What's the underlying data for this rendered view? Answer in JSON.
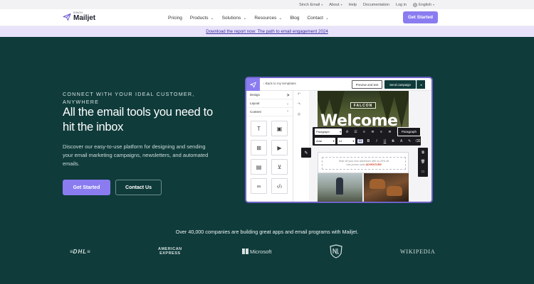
{
  "topbar": {
    "items": [
      {
        "label": "Sinch Email",
        "chevron": true
      },
      {
        "label": "About",
        "chevron": true
      },
      {
        "label": "Help",
        "chevron": false
      },
      {
        "label": "Documentation",
        "chevron": false
      },
      {
        "label": "Log in",
        "chevron": false
      },
      {
        "label": "English",
        "chevron": true,
        "icon": "globe-icon"
      }
    ]
  },
  "nav": {
    "logo_sub": "SINCH",
    "logo_main": "Mailjet",
    "menu": [
      {
        "label": "Pricing",
        "chevron": false
      },
      {
        "label": "Products",
        "chevron": true
      },
      {
        "label": "Solutions",
        "chevron": true
      },
      {
        "label": "Resources",
        "chevron": true
      },
      {
        "label": "Blog",
        "chevron": false
      },
      {
        "label": "Contact",
        "chevron": true
      }
    ],
    "cta": "Get Started"
  },
  "banner": {
    "link": "Download the report now: The path to email engagement 2024"
  },
  "hero": {
    "eyebrow": "CONNECT WITH YOUR IDEAL CUSTOMER, ANYWHERE",
    "headline": "All the email tools you need to hit the inbox",
    "description": "Discover our easy-to-use platform for designing and sending your email marketing campaigns, newsletters, and automated emails.",
    "primary_cta": "Get Started",
    "secondary_cta": "Contact Us"
  },
  "editor": {
    "back_link": "Back to my templates",
    "preview_button": "Preview and test",
    "send_button": "Send campaign",
    "sections": [
      "Design",
      "Layout",
      "Content"
    ],
    "brand_name": "FALCON",
    "welcome_text": "Welcome",
    "body_text_line1": "Start off your new adventure with us 20% off",
    "body_text_line2": "Use promo code",
    "promo_code": "ADVENTURE",
    "format_style": "Paragraph",
    "format_font": "Arial",
    "format_size": "14",
    "tooltip": "Paragraph"
  },
  "trust": {
    "headline": "Over 40,000 companies are building great apps and email programs with Mailjet.",
    "logos": {
      "dhl": "DHL",
      "amex_line1": "AMERICAN",
      "amex_line2": "EXPRESS",
      "microsoft": "Microsoft",
      "wikipedia": "WIKIPEDIA"
    }
  },
  "colors": {
    "background": "#0f3b3a",
    "accent": "#8a7cf0",
    "banner_bg": "#e8e3fb",
    "banner_link": "#3d2d9e"
  }
}
